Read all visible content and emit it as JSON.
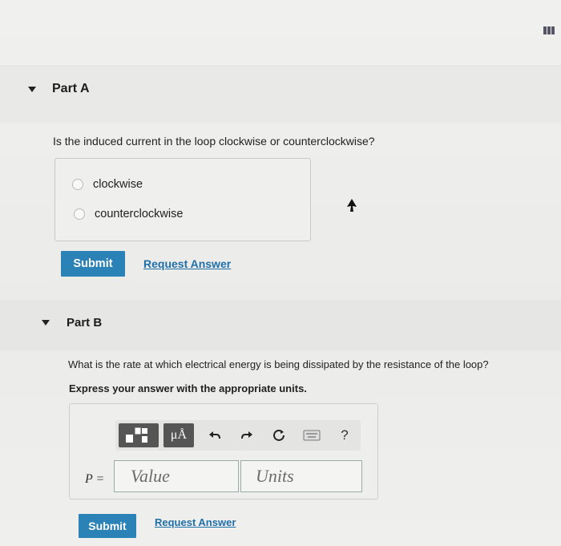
{
  "partA": {
    "title": "Part A",
    "question": "Is the induced current in the loop clockwise or counterclockwise?",
    "options": [
      {
        "label": "clockwise"
      },
      {
        "label": "counterclockwise"
      }
    ],
    "submit_label": "Submit",
    "request_label": "Request Answer"
  },
  "partB": {
    "title": "Part B",
    "question": "What is the rate at which electrical energy is being dissipated by the resistance of the loop?",
    "instruction": "Express your answer with the appropriate units.",
    "toolbar": {
      "units_button": "μÅ",
      "help_label": "?",
      "icons": [
        "templates-icon",
        "units-icon",
        "undo-icon",
        "redo-icon",
        "reset-icon",
        "keyboard-icon",
        "help-icon"
      ]
    },
    "variable_label": "P =",
    "value_placeholder": "Value",
    "units_placeholder": "Units",
    "submit_label": "Submit",
    "request_label": "Request Answer"
  },
  "colors": {
    "accent": "#2b82b7",
    "link": "#1f6fa8"
  }
}
